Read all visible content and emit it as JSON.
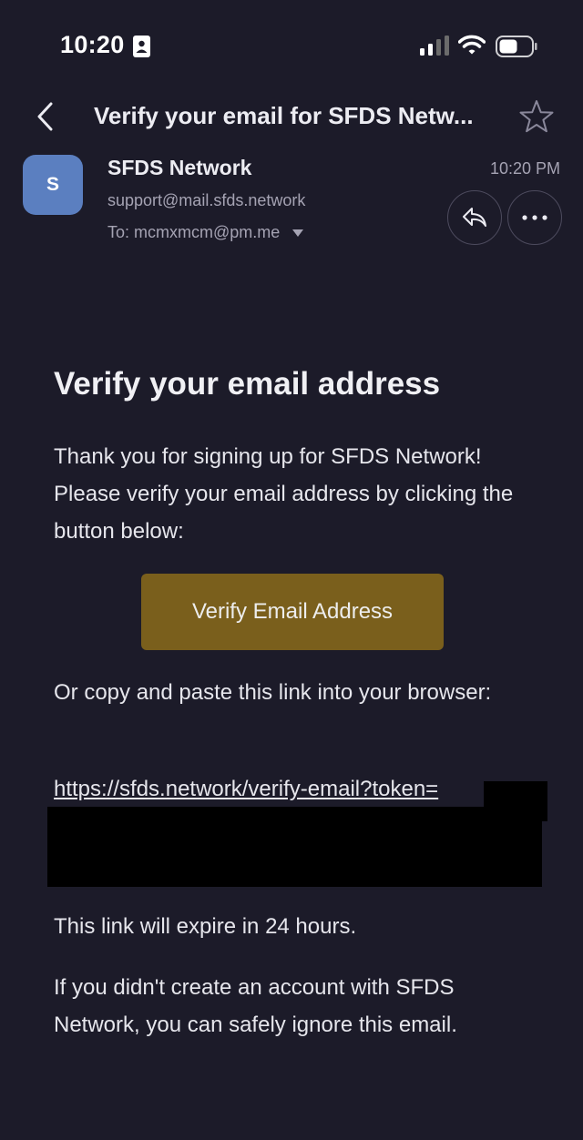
{
  "status_bar": {
    "time": "10:20",
    "icons": [
      "id-card-icon",
      "cellular-signal-icon",
      "wifi-icon",
      "battery-icon"
    ]
  },
  "header": {
    "subject": "Verify your email for SFDS Netw...",
    "icons": [
      "back-chevron-icon",
      "star-icon"
    ]
  },
  "sender": {
    "avatar_initial": "S",
    "avatar_color": "#5b7fc0",
    "name": "SFDS Network",
    "email": "support@mail.sfds.network",
    "recipient": "To: mcmxmcm@pm.me",
    "time": "10:20 PM",
    "actions": [
      "reply-icon",
      "more-icon"
    ]
  },
  "message": {
    "heading": "Verify your email address",
    "intro": "Thank you for signing up for SFDS Network! Please verify your email address by clicking the button below:",
    "button_label": "Verify Email Address",
    "button_color": "#7a5f1c",
    "copy_text": "Or copy and paste this link into your browser:",
    "link_text": "https://sfds.network/verify-email?token=",
    "expire_text": "This link will expire in 24 hours.",
    "ignore_text": "If you didn't create an account with SFDS Network, you can safely ignore this email."
  },
  "colors": {
    "background": "#1c1b29",
    "secondary_text": "#a5a3b3",
    "redaction": "#000000"
  }
}
